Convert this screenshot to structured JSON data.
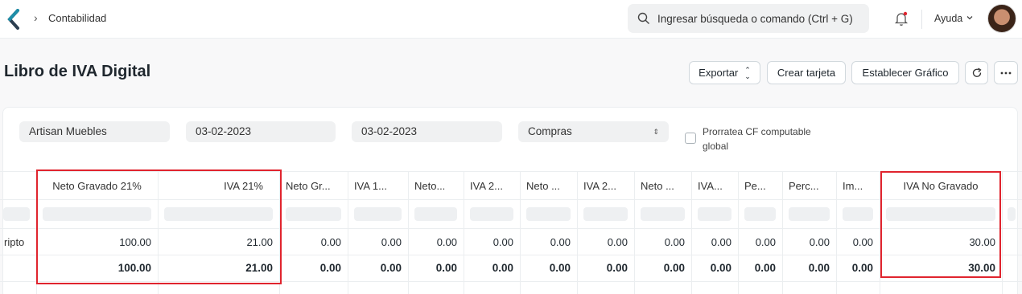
{
  "navbar": {
    "breadcrumb": "Contabilidad",
    "search_placeholder": "Ingresar búsqueda o comando (Ctrl + G)",
    "help_label": "Ayuda"
  },
  "page": {
    "title": "Libro de IVA Digital",
    "actions": {
      "export_label": "Exportar",
      "create_card_label": "Crear tarjeta",
      "set_chart_label": "Establecer Gráfico"
    }
  },
  "filters": {
    "company": "Artisan Muebles",
    "from_date": "03-02-2023",
    "to_date": "03-02-2023",
    "type": "Compras",
    "prorate_label": "Prorratea CF computable global"
  },
  "table": {
    "headers": [
      "Neto Gravado 21%",
      "IVA 21%",
      "Neto Gr...",
      "IVA 1...",
      "Neto...",
      "IVA 2...",
      "Neto ...",
      "IVA 2...",
      "Neto ...",
      "IVA...",
      "Pe...",
      "Perc...",
      "Im...",
      "IVA No Gravado"
    ],
    "first_col_fragment": "ripto",
    "row": [
      "100.00",
      "21.00",
      "0.00",
      "0.00",
      "0.00",
      "0.00",
      "0.00",
      "0.00",
      "0.00",
      "0.00",
      "0.00",
      "0.00",
      "0.00",
      "30.00"
    ],
    "total": [
      "100.00",
      "21.00",
      "0.00",
      "0.00",
      "0.00",
      "0.00",
      "0.00",
      "0.00",
      "0.00",
      "0.00",
      "0.00",
      "0.00",
      "0.00",
      "30.00"
    ]
  },
  "colors": {
    "highlight_border": "#e0242e",
    "surface": "#ffffff",
    "control_bg": "#f0f1f2"
  }
}
